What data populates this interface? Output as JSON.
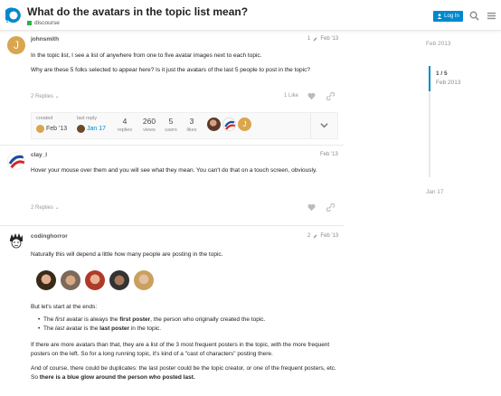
{
  "header": {
    "title": "What do the avatars in the topic list mean?",
    "category": "discourse",
    "login_label": "Log In",
    "category_color": "#2bb24c",
    "accent": "#0088cc"
  },
  "timeline": {
    "start": "Feb 2013",
    "position": "1 / 5",
    "current_date": "Feb 2013",
    "end": "Jan 17"
  },
  "posts": [
    {
      "username": "johnsmith",
      "avatar_letter": "J",
      "post_number": "1",
      "date": "Feb '13",
      "paragraphs": [
        "In the topic list, I see a list of anywhere from one to five avatar images next to each topic.",
        "Why are these 5 folks selected to appear here? Is it just the avatars of the last 5 people to post in the topic?"
      ],
      "replies_label": "2 Replies",
      "like_label": "1 Like"
    },
    {
      "username": "clay_l",
      "date": "Feb '13",
      "paragraphs": [
        "Hover your mouse over them and you will see what they mean. You can't do that on a touch screen, obviously."
      ],
      "replies_label": "2 Replies"
    },
    {
      "username": "codinghorror",
      "post_number": "2",
      "date": "Feb '13",
      "intro": "Naturally this will depend a little how many people are posting in the topic.",
      "start_text": "But let's start at the ends:",
      "bullets": [
        {
          "pre": "The ",
          "em": "first",
          "mid": " avatar is always the ",
          "strong": "first poster",
          "post": ", the person who originally created the topic."
        },
        {
          "pre": "The ",
          "em": "last",
          "mid": " avatar is the ",
          "strong": "last poster",
          "post": " in the topic."
        }
      ],
      "para3": "If there are more avatars than that, they are a list of the 3 most frequent posters in the topic, with the more frequent posters on the left. So for a long running topic, it's kind of a \"cast of characters\" posting there.",
      "para4_pre": "And of course, there could be duplicates: the last poster could be the topic creator, or one of the frequent posters, etc. So ",
      "para4_strong": "there is a blue glow around the person who posted last."
    }
  ],
  "topic_map": {
    "created_label": "created",
    "created_date": "Feb '13",
    "last_reply_label": "last reply",
    "last_reply_date": "Jan 17",
    "stats": [
      {
        "value": "4",
        "label": "replies"
      },
      {
        "value": "260",
        "label": "views"
      },
      {
        "value": "5",
        "label": "users"
      },
      {
        "value": "3",
        "label": "likes"
      }
    ]
  }
}
